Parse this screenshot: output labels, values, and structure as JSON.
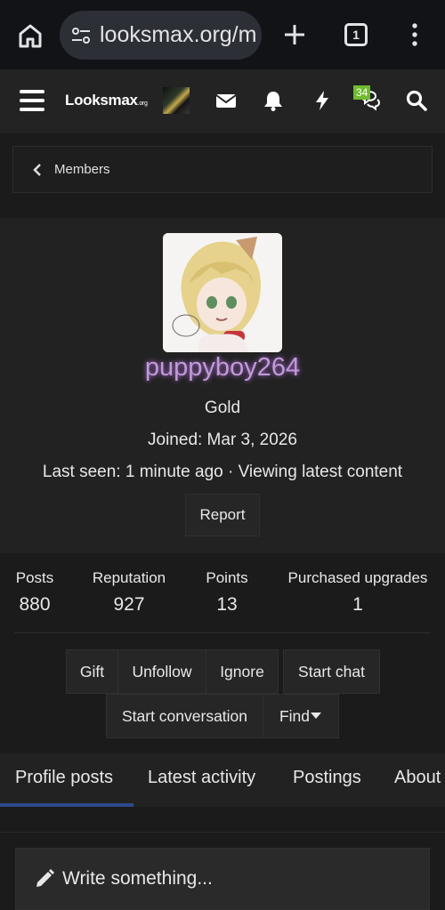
{
  "browser": {
    "url": "looksmax.org/m",
    "tab_count": "1"
  },
  "header": {
    "logo_main": "Lοοksmax",
    "logo_sub": ".org",
    "notification_badge": "34"
  },
  "breadcrumb": {
    "label": "Members"
  },
  "profile": {
    "username": "puppyboy264",
    "rank": "Gold",
    "joined": "Joined: Mar 3, 2026",
    "last_seen": "Last seen: 1 minute ago · Viewing latest content",
    "report_label": "Report"
  },
  "stats": [
    {
      "label": "Posts",
      "value": "880"
    },
    {
      "label": "Reputation",
      "value": "927"
    },
    {
      "label": "Points",
      "value": "13"
    },
    {
      "label": "Purchased upgrades",
      "value": "1"
    }
  ],
  "actions": {
    "gift": "Gift",
    "unfollow": "Unfollow",
    "ignore": "Ignore",
    "start_chat": "Start chat",
    "start_conversation": "Start conversation",
    "find": "Find"
  },
  "tabs": [
    "Profile posts",
    "Latest activity",
    "Postings",
    "About"
  ],
  "compose": {
    "placeholder": "Write something..."
  },
  "colors": {
    "username": "#c09ad8",
    "active_tab": "#2d4a8a",
    "badge": "#6fbb2e"
  }
}
